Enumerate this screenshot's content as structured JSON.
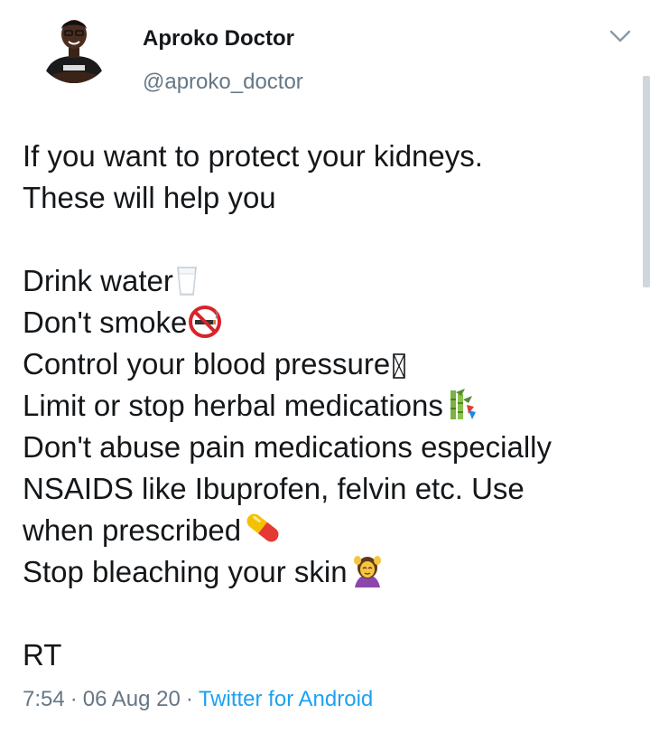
{
  "user": {
    "display_name": "Aproko Doctor",
    "handle": "@aproko_doctor",
    "avatar_icon": "profile-photo"
  },
  "tweet": {
    "lines": [
      "If you want to protect your kidneys.",
      "These will help you",
      "",
      "Drink water",
      "Don't smoke",
      "Control your blood pressure",
      "Limit or stop herbal medications",
      "Don't abuse pain medications especially",
      "NSAIDS like Ibuprofen, felvin etc. Use",
      "when prescribed",
      "Stop bleaching your skin",
      "",
      "RT"
    ],
    "emojis": {
      "drink_water": "glass-of-milk-icon",
      "dont_smoke": "no-smoking-icon",
      "blood_pressure": "missing-glyph-icon",
      "herbal": "bamboo-decoration-icon",
      "prescribed": "pill-icon",
      "skin": "woman-getting-massage-icon"
    }
  },
  "meta": {
    "time": "7:54",
    "date": "06 Aug 20",
    "separator": "·",
    "source": "Twitter for Android"
  },
  "colors": {
    "text": "#14171a",
    "secondary": "#657786",
    "link": "#1da1f2"
  }
}
